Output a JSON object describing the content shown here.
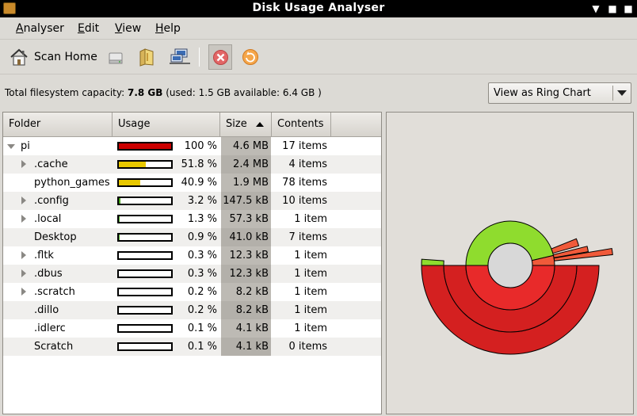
{
  "window": {
    "title": "Disk Usage Analyser"
  },
  "menu": {
    "items": [
      {
        "label": "Analyser",
        "accel": "A",
        "rest": "nalyser"
      },
      {
        "label": "Edit",
        "accel": "E",
        "rest": "dit"
      },
      {
        "label": "View",
        "accel": "V",
        "rest": "iew"
      },
      {
        "label": "Help",
        "accel": "H",
        "rest": "elp"
      }
    ]
  },
  "toolbar": {
    "scan_home_label": "Scan Home",
    "icons": [
      "home-icon",
      "drive-icon",
      "folder-icon",
      "network-icon",
      "stop-icon",
      "refresh-icon"
    ]
  },
  "capacity": {
    "prefix": "Total filesystem capacity: ",
    "total": "7.8 GB",
    "detail": " (used: 1.5 GB available: 6.4 GB )"
  },
  "view_select": {
    "value": "View as Ring Chart"
  },
  "table": {
    "headers": {
      "folder": "Folder",
      "usage": "Usage",
      "size": "Size",
      "contents": "Contents"
    },
    "rows": [
      {
        "name": "pi",
        "level": 0,
        "expander": "open",
        "pct": "100 %",
        "fraction": 1.0,
        "bar_color": "#cc0000",
        "size": "4.6 MB",
        "contents": "17 items"
      },
      {
        "name": ".cache",
        "level": 1,
        "expander": "closed",
        "pct": "51.8 %",
        "fraction": 0.518,
        "bar_color": "#e8c800",
        "size": "2.4 MB",
        "contents": "4 items"
      },
      {
        "name": "python_games",
        "level": 1,
        "expander": "none",
        "pct": "40.9 %",
        "fraction": 0.409,
        "bar_color": "#e8c800",
        "size": "1.9 MB",
        "contents": "78 items"
      },
      {
        "name": ".config",
        "level": 1,
        "expander": "closed",
        "pct": "3.2 %",
        "fraction": 0.032,
        "bar_color": "#4caa20",
        "size": "147.5 kB",
        "contents": "10 items"
      },
      {
        "name": ".local",
        "level": 1,
        "expander": "closed",
        "pct": "1.3 %",
        "fraction": 0.013,
        "bar_color": "#4caa20",
        "size": "57.3 kB",
        "contents": "1 item"
      },
      {
        "name": "Desktop",
        "level": 1,
        "expander": "none",
        "pct": "0.9 %",
        "fraction": 0.009,
        "bar_color": "#4caa20",
        "size": "41.0 kB",
        "contents": "7 items"
      },
      {
        "name": ".fltk",
        "level": 1,
        "expander": "closed",
        "pct": "0.3 %",
        "fraction": 0.003,
        "bar_color": "#4caa20",
        "size": "12.3 kB",
        "contents": "1 item"
      },
      {
        "name": ".dbus",
        "level": 1,
        "expander": "closed",
        "pct": "0.3 %",
        "fraction": 0.003,
        "bar_color": "#4caa20",
        "size": "12.3 kB",
        "contents": "1 item"
      },
      {
        "name": ".scratch",
        "level": 1,
        "expander": "closed",
        "pct": "0.2 %",
        "fraction": 0.002,
        "bar_color": "#4caa20",
        "size": "8.2 kB",
        "contents": "1 item"
      },
      {
        "name": ".dillo",
        "level": 1,
        "expander": "none",
        "pct": "0.2 %",
        "fraction": 0.002,
        "bar_color": "#4caa20",
        "size": "8.2 kB",
        "contents": "1 item"
      },
      {
        "name": ".idlerc",
        "level": 1,
        "expander": "none",
        "pct": "0.1 %",
        "fraction": 0.001,
        "bar_color": "#4caa20",
        "size": "4.1 kB",
        "contents": "1 item"
      },
      {
        "name": "Scratch",
        "level": 1,
        "expander": "none",
        "pct": "0.1 %",
        "fraction": 0.001,
        "bar_color": "#4caa20",
        "size": "4.1 kB",
        "contents": "0 items"
      }
    ]
  },
  "colors": {
    "ring_red": "#e82a2a",
    "ring_red_dark": "#d42020",
    "ring_green": "#8fdc2e",
    "ring_orange": "#f05a3a",
    "center": "#d8d8d8"
  }
}
